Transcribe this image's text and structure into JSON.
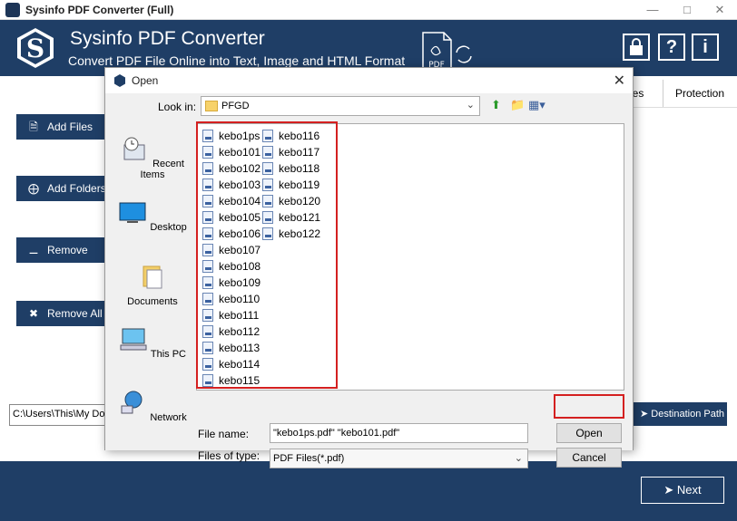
{
  "window": {
    "title": "Sysinfo PDF Converter (Full)"
  },
  "header": {
    "title": "Sysinfo PDF Converter",
    "subtitle": "Convert PDF File Online into Text, Image and HTML Format",
    "pdf_badge": "PDF"
  },
  "columns": [
    "ges",
    "Protection"
  ],
  "sidebar": {
    "add_files": "Add Files",
    "add_folders": "Add Folders",
    "remove": "Remove",
    "remove_all": "Remove All"
  },
  "path": {
    "value": "C:\\Users\\This\\My Doc"
  },
  "destination_button": "Destination Path",
  "next_button": "Next",
  "dialog": {
    "title": "Open",
    "look_in_label": "Look in:",
    "look_in_value": "PFGD",
    "places": [
      "Recent Items",
      "Desktop",
      "Documents",
      "This PC",
      "Network"
    ],
    "files_col1": [
      "kebo1ps",
      "kebo101",
      "kebo102",
      "kebo103",
      "kebo104",
      "kebo105",
      "kebo106",
      "kebo107",
      "kebo108",
      "kebo109",
      "kebo110",
      "kebo111",
      "kebo112",
      "kebo113",
      "kebo114",
      "kebo115"
    ],
    "files_col2": [
      "kebo116",
      "kebo117",
      "kebo118",
      "kebo119",
      "kebo120",
      "kebo121",
      "kebo122"
    ],
    "file_name_label": "File name:",
    "file_name_value": "\"kebo1ps.pdf\" \"kebo101.pdf\"",
    "file_type_label": "Files of type:",
    "file_type_value": "PDF Files(*.pdf)",
    "open_button": "Open",
    "cancel_button": "Cancel"
  }
}
